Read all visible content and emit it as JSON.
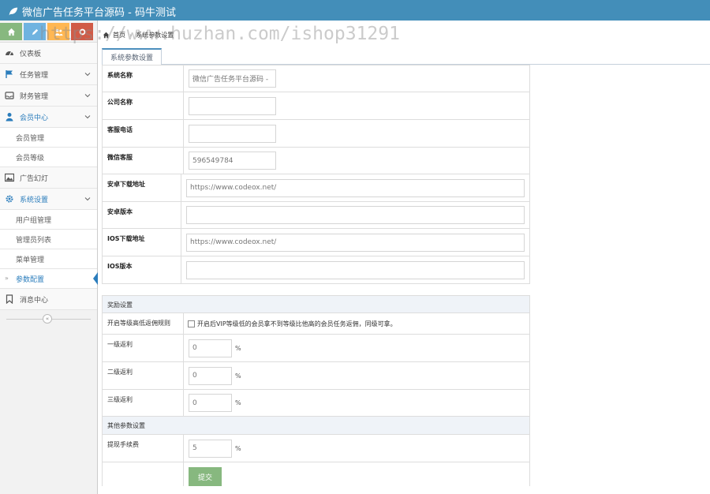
{
  "app": {
    "title": "微信广告任务平台源码 - 码牛测试"
  },
  "colors": {
    "navbar": "#438eb9",
    "primary": "#2b7dbc",
    "submit": "#87b87f",
    "sc_green": "#87b87f",
    "sc_blue": "#6fb3e0",
    "sc_orange": "#ffb752",
    "sc_red": "#d15b47"
  },
  "watermark": "https://www.huzhan.com/ishop31291",
  "sidebar": {
    "items": [
      {
        "label": "仪表板",
        "icon": "dashboard-icon"
      },
      {
        "label": "任务管理",
        "icon": "flag-icon"
      },
      {
        "label": "财务管理",
        "icon": "inbox-icon"
      },
      {
        "label": "会员中心",
        "icon": "user-icon"
      },
      {
        "label": "广告幻灯",
        "icon": "picture-icon"
      },
      {
        "label": "系统设置",
        "icon": "gear-icon"
      },
      {
        "label": "消息中心",
        "icon": "bookmark-icon"
      }
    ],
    "member_sub": [
      "会员管理",
      "会员等级"
    ],
    "system_sub": [
      "用户组管理",
      "管理员列表",
      "菜单管理",
      "参数配置"
    ],
    "collapse_symbol": "«"
  },
  "breadcrumb": {
    "home": "首页",
    "current": "系统参数设置"
  },
  "tab": {
    "label": "系统参数设置"
  },
  "form": {
    "system_name": {
      "label": "系统名称",
      "value": "微信广告任务平台源码 -"
    },
    "company_name": {
      "label": "公司名称",
      "value": ""
    },
    "service_phone": {
      "label": "客服电话",
      "value": ""
    },
    "wechat_service": {
      "label": "微信客服",
      "value": "596549784"
    },
    "android_url": {
      "label": "安卓下载地址",
      "value": "https://www.codeox.net/"
    },
    "android_version": {
      "label": "安卓版本",
      "value": ""
    },
    "ios_url": {
      "label": "IOS下载地址",
      "value": "https://www.codeox.net/"
    },
    "ios_version": {
      "label": "IOS版本",
      "value": ""
    },
    "reward_section": "奖励设置",
    "rule": {
      "label": "开启等级高低返佣规则",
      "text": "开启后VIP等级低的会员拿不到等级比他高的会员任务返佣，同级可拿。"
    },
    "level1": {
      "label": "一级返利",
      "value": "0",
      "unit": "%"
    },
    "level2": {
      "label": "二级返利",
      "value": "0",
      "unit": "%"
    },
    "level3": {
      "label": "三级返利",
      "value": "0",
      "unit": "%"
    },
    "other_section": "其他参数设置",
    "withdraw_fee": {
      "label": "提现手续费",
      "value": "5",
      "unit": "%"
    },
    "submit_label": "提交"
  }
}
